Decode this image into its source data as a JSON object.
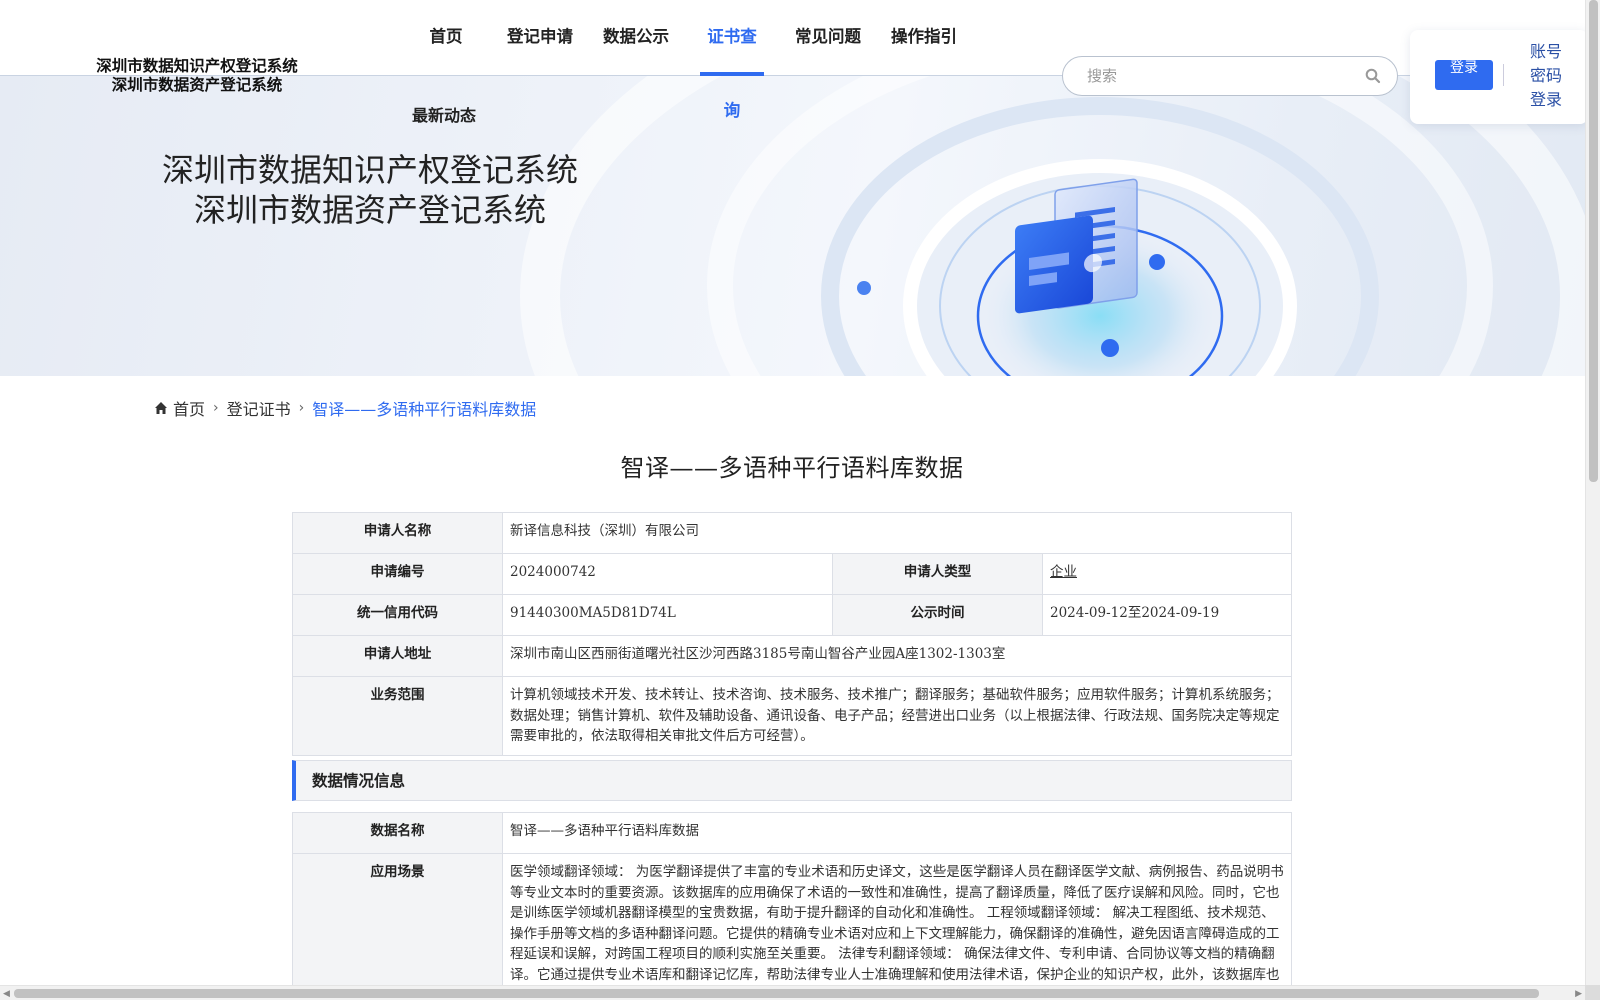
{
  "logo": {
    "line1": "深圳市数据知识产权登记系统",
    "line2": "深圳市数据资产登记系统"
  },
  "nav": {
    "items": [
      "首页",
      "登记申请",
      "数据公示",
      "证书查询",
      "常见问题",
      "操作指引"
    ],
    "active_index": 3,
    "second_row": "最新动态"
  },
  "search": {
    "placeholder": "搜索",
    "value": ""
  },
  "login": {
    "button": "登录",
    "account_link": [
      "账号",
      "密码",
      "登录"
    ]
  },
  "banner": {
    "title_line1": "深圳市数据知识产权登记系统",
    "title_line2": "深圳市数据资产登记系统"
  },
  "breadcrumb": [
    "首页",
    "登记证书",
    "智译——多语种平行语料库数据"
  ],
  "page_title": "智译——多语种平行语料库数据",
  "applicant": {
    "name_label": "申请人名称",
    "name": "新译信息科技（深圳）有限公司",
    "app_no_label": "申请编号",
    "app_no": "2024000742",
    "type_label": "申请人类型",
    "type": "企业",
    "credit_code_label": "统一信用代码",
    "credit_code": "91440300MA5D81D74L",
    "publicity_label": "公示时间",
    "publicity": "2024-09-12至2024-09-19",
    "address_label": "申请人地址",
    "address": "深圳市南山区西丽街道曙光社区沙河西路3185号南山智谷产业园A座1302-1303室",
    "scope_label": "业务范围",
    "scope": "计算机领域技术开发、技术转让、技术咨询、技术服务、技术推广；翻译服务；基础软件服务；应用软件服务；计算机系统服务；数据处理；销售计算机、软件及辅助设备、通讯设备、电子产品；经营进出口业务（以上根据法律、行政法规、国务院决定等规定需要审批的，依法取得相关审批文件后方可经营）。"
  },
  "data_section": {
    "heading": "数据情况信息",
    "name_label": "数据名称",
    "name": "智译——多语种平行语料库数据",
    "scene_label": "应用场景",
    "scene": "医学领域翻译领域： 为医学翻译提供了丰富的专业术语和历史译文，这些是医学翻译人员在翻译医学文献、病例报告、药品说明书等专业文本时的重要资源。该数据库的应用确保了术语的一致性和准确性，提高了翻译质量，降低了医疗误解和风险。同时，它也是训练医学领域机器翻译模型的宝贵数据，有助于提升翻译的自动化和准确性。 工程领域翻译领域： 解决工程图纸、技术规范、操作手册等文档的多语种翻译问题。它提供的精确专业术语对应和上下文理解能力，确保翻译的准确性，避免因语言障碍造成的工程延误和误解，对跨国工程项目的顺利实施至关重要。 法律专利翻译领域： 确保法律文件、专利申请、合同协议等文档的精确翻译。它通过提供专业术语库和翻译记忆库，帮助法律专业人士准确理解和使用法律术语，保护企业的知识产权，此外，该数据库也是训练法律领域机器翻译模型的重要数据源，提高翻译的自动化水平，降低成本，保障安全和"
  }
}
